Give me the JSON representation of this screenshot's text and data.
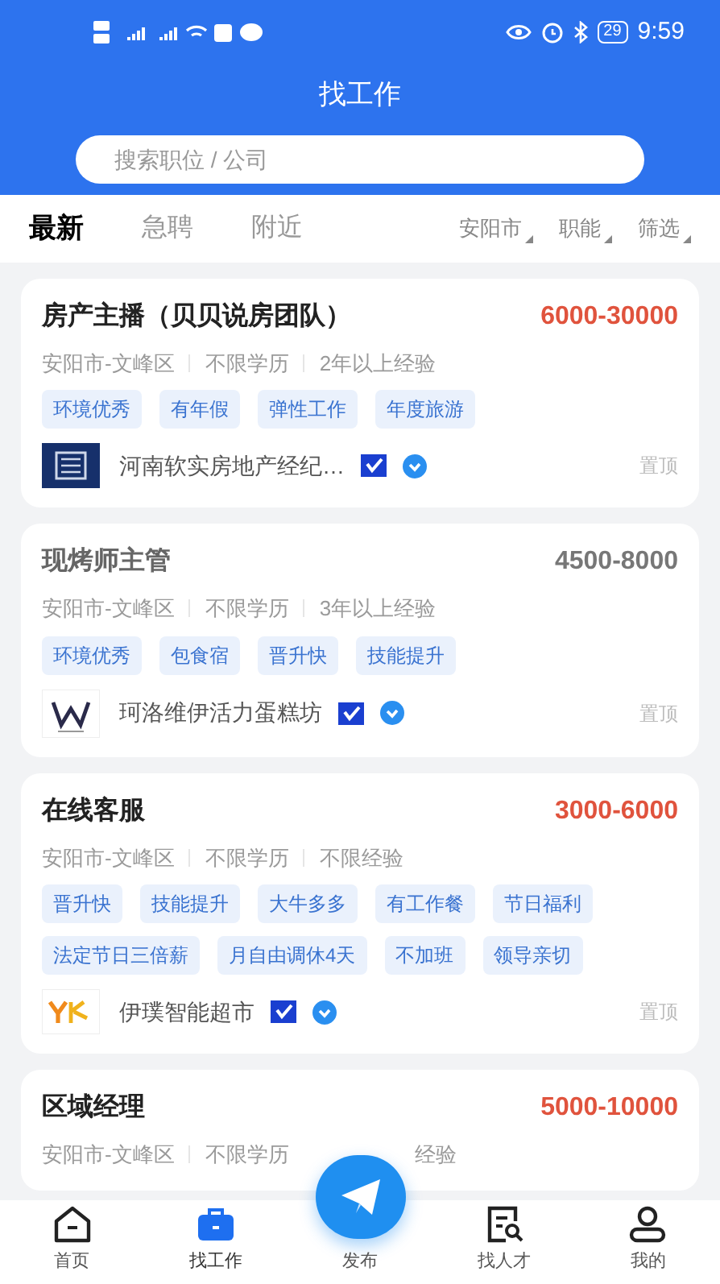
{
  "status_bar": {
    "time": "9:59",
    "battery": "29"
  },
  "header": {
    "title": "找工作",
    "search": {
      "placeholder": "搜索职位 / 公司"
    }
  },
  "tabs": [
    {
      "label": "最新",
      "selected": true
    },
    {
      "label": "急聘",
      "selected": false
    },
    {
      "label": "附近",
      "selected": false
    }
  ],
  "filters": [
    {
      "label": "安阳市"
    },
    {
      "label": "职能"
    },
    {
      "label": "筛选"
    }
  ],
  "jobs": [
    {
      "title": "房产主播（贝贝说房团队）",
      "salary": "6000-30000",
      "dimmed": false,
      "meta": [
        "安阳市-文峰区",
        "不限学历",
        "2年以上经验"
      ],
      "tags": [
        "环境优秀",
        "有年假",
        "弹性工作",
        "年度旅游"
      ],
      "company": "河南软实房地产经纪…",
      "kind": "square",
      "pin": "置顶"
    },
    {
      "title": "现烤师主管",
      "salary": "4500-8000",
      "dimmed": true,
      "meta": [
        "安阳市-文峰区",
        "不限学历",
        "3年以上经验"
      ],
      "tags": [
        "环境优秀",
        "包食宿",
        "晋升快",
        "技能提升"
      ],
      "company": "珂洛维伊活力蛋糕坊",
      "kind": "w",
      "pin": "置顶"
    },
    {
      "title": "在线客服",
      "salary": "3000-6000",
      "dimmed": false,
      "meta": [
        "安阳市-文峰区",
        "不限学历",
        "不限经验"
      ],
      "tags": [
        "晋升快",
        "技能提升",
        "大牛多多",
        "有工作餐",
        "节日福利",
        "法定节日三倍薪",
        "月自由调休4天",
        "不加班",
        "领导亲切"
      ],
      "company": "伊璞智能超市",
      "kind": "y",
      "pin": "置顶"
    },
    {
      "title": "区域经理",
      "salary": "5000-10000",
      "dimmed": false,
      "meta": [
        "安阳市-文峰区",
        "不限学历",
        "经验"
      ],
      "covered": true
    }
  ],
  "nav": [
    {
      "label": "首页",
      "kind": "home",
      "selected": false
    },
    {
      "label": "找工作",
      "kind": "bag",
      "selected": true
    },
    {
      "label": "发布",
      "kind": "plane",
      "selected": false
    },
    {
      "label": "找人才",
      "kind": "search-doc",
      "selected": false
    },
    {
      "label": "我的",
      "kind": "user",
      "selected": false
    }
  ]
}
